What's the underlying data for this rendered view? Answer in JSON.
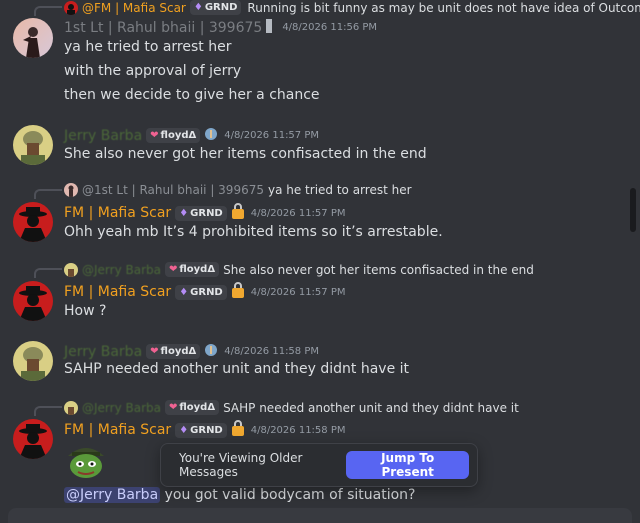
{
  "colors": {
    "background": "#313338",
    "fm_name": "#f0a020",
    "jerry_name": "#4e8a2c",
    "rahul_name": "#7a7d82",
    "accent": "#5865f2"
  },
  "top_reply": {
    "author": "@FM | Mafia Scar",
    "tag": "GRND",
    "text": "Running is bit funny as may be unit does not have idea of Outcome ..."
  },
  "messages": [
    {
      "author": "1st Lt  | Rahul bhaii | 399675",
      "timestamp": "4/8/2026 11:56 PM",
      "lines": [
        "ya he tried to arrest her",
        "with the approval of jerry",
        "then we decide to give her a chance"
      ]
    },
    {
      "author": "Jerry Barba",
      "tag": "floydΔ",
      "timestamp": "4/8/2026 11:57 PM",
      "lines": [
        "She also never got her items confisacted in the end"
      ]
    },
    {
      "reply_author": "@1st Lt  | Rahul bhaii | 399675",
      "reply_text": "ya he tried to arrest her",
      "author": "FM | Mafia Scar",
      "tag": "GRND",
      "timestamp": "4/8/2026 11:57 PM",
      "lines": [
        "Ohh yeah mb It’s 4 prohibited items so it’s arrestable."
      ]
    },
    {
      "reply_author": "@Jerry Barba",
      "reply_tag": "floydΔ",
      "reply_text": "She also never got her items confisacted in the end",
      "author": "FM | Mafia Scar",
      "tag": "GRND",
      "timestamp": "4/8/2026 11:57 PM",
      "lines": [
        "How ?"
      ]
    },
    {
      "author": "Jerry Barba",
      "tag": "floydΔ",
      "timestamp": "4/8/2026 11:58 PM",
      "lines": [
        "SAHP needed another unit and they didnt have it"
      ]
    },
    {
      "reply_author": "@Jerry Barba",
      "reply_tag": "floydΔ",
      "reply_text": "SAHP needed another unit and they didnt have it",
      "author": "FM | Mafia Scar",
      "tag": "GRND",
      "timestamp": "4/8/2026 11:58 PM",
      "mention": "@Jerry Barba",
      "lines": [
        "you got valid bodycam of situation?"
      ]
    }
  ],
  "banner": {
    "text": "You're Viewing Older Messages",
    "button": "Jump To Present"
  }
}
